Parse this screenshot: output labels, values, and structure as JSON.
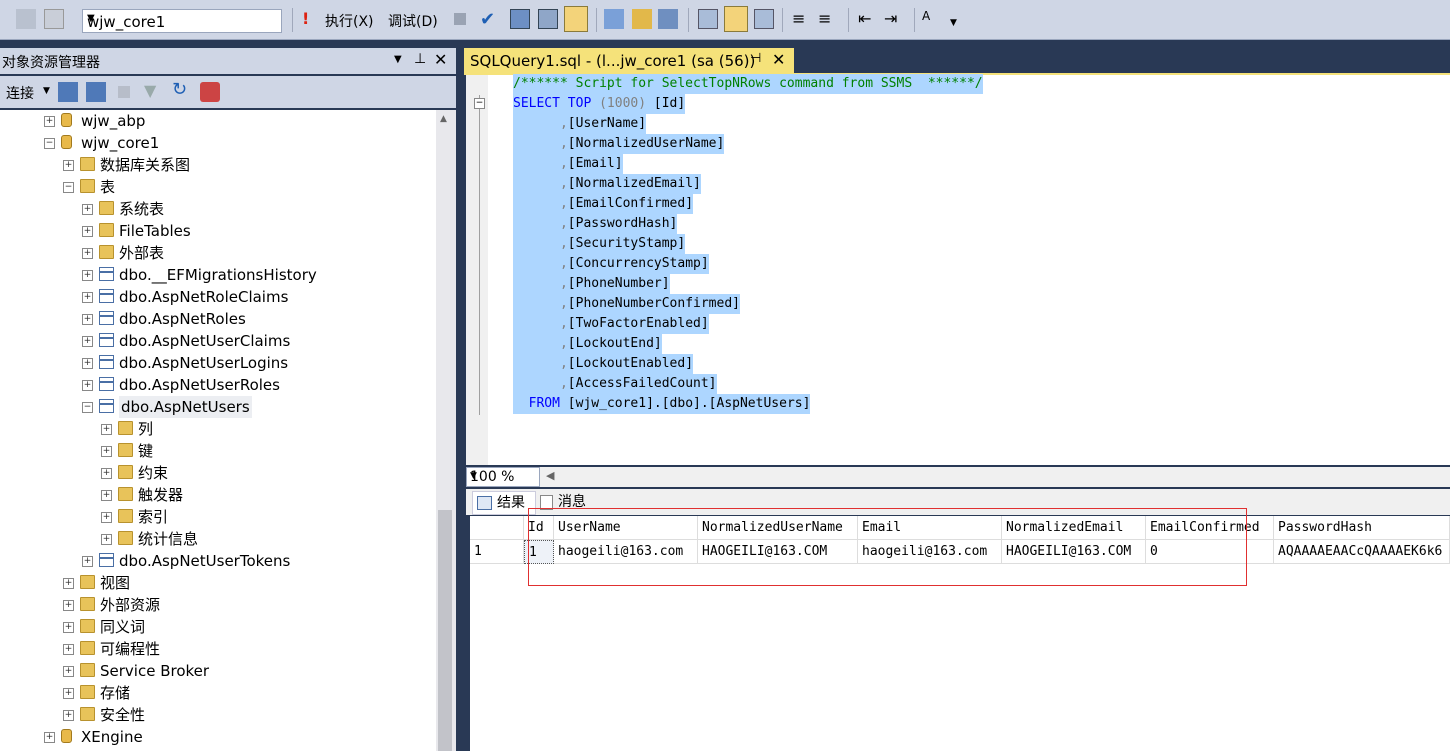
{
  "toolbar": {
    "database": "wjw_core1",
    "execute_label": "执行(X)",
    "debug_label": "调试(D)"
  },
  "object_explorer": {
    "title": "对象资源管理器",
    "connect_label": "连接",
    "tree": [
      {
        "label": "wjw_abp",
        "type": "db",
        "level": 2,
        "expanded": false
      },
      {
        "label": "wjw_core1",
        "type": "db",
        "level": 2,
        "expanded": true
      },
      {
        "label": "数据库关系图",
        "type": "folder",
        "level": 3,
        "expanded": false
      },
      {
        "label": "表",
        "type": "folder",
        "level": 3,
        "expanded": true
      },
      {
        "label": "系统表",
        "type": "folder",
        "level": 4,
        "expanded": false
      },
      {
        "label": "FileTables",
        "type": "folder",
        "level": 4,
        "expanded": false
      },
      {
        "label": "外部表",
        "type": "folder",
        "level": 4,
        "expanded": false
      },
      {
        "label": "dbo.__EFMigrationsHistory",
        "type": "table",
        "level": 4,
        "expanded": false
      },
      {
        "label": "dbo.AspNetRoleClaims",
        "type": "table",
        "level": 4,
        "expanded": false
      },
      {
        "label": "dbo.AspNetRoles",
        "type": "table",
        "level": 4,
        "expanded": false
      },
      {
        "label": "dbo.AspNetUserClaims",
        "type": "table",
        "level": 4,
        "expanded": false
      },
      {
        "label": "dbo.AspNetUserLogins",
        "type": "table",
        "level": 4,
        "expanded": false
      },
      {
        "label": "dbo.AspNetUserRoles",
        "type": "table",
        "level": 4,
        "expanded": false
      },
      {
        "label": "dbo.AspNetUsers",
        "type": "table",
        "level": 4,
        "expanded": true
      },
      {
        "label": "列",
        "type": "folder",
        "level": 5,
        "expanded": false
      },
      {
        "label": "键",
        "type": "folder",
        "level": 5,
        "expanded": false
      },
      {
        "label": "约束",
        "type": "folder",
        "level": 5,
        "expanded": false
      },
      {
        "label": "触发器",
        "type": "folder",
        "level": 5,
        "expanded": false
      },
      {
        "label": "索引",
        "type": "folder",
        "level": 5,
        "expanded": false
      },
      {
        "label": "统计信息",
        "type": "folder",
        "level": 5,
        "expanded": false
      },
      {
        "label": "dbo.AspNetUserTokens",
        "type": "table",
        "level": 4,
        "expanded": false
      },
      {
        "label": "视图",
        "type": "folder",
        "level": 3,
        "expanded": false
      },
      {
        "label": "外部资源",
        "type": "folder",
        "level": 3,
        "expanded": false
      },
      {
        "label": "同义词",
        "type": "folder",
        "level": 3,
        "expanded": false
      },
      {
        "label": "可编程性",
        "type": "folder",
        "level": 3,
        "expanded": false
      },
      {
        "label": "Service Broker",
        "type": "folder",
        "level": 3,
        "expanded": false
      },
      {
        "label": "存储",
        "type": "folder",
        "level": 3,
        "expanded": false
      },
      {
        "label": "安全性",
        "type": "folder",
        "level": 3,
        "expanded": false
      },
      {
        "label": "XEngine",
        "type": "db",
        "level": 2,
        "expanded": false
      }
    ]
  },
  "editor": {
    "tab_title": "SQLQuery1.sql - (l...jw_core1 (sa (56))",
    "lines": [
      {
        "text": "/****** Script for SelectTopNRows command from SSMS  ******/",
        "kind": "comment"
      },
      {
        "text": "SELECT TOP (1000) [Id]",
        "kind": "select"
      },
      {
        "text": "      ,[UserName]",
        "kind": "col"
      },
      {
        "text": "      ,[NormalizedUserName]",
        "kind": "col"
      },
      {
        "text": "      ,[Email]",
        "kind": "col"
      },
      {
        "text": "      ,[NormalizedEmail]",
        "kind": "col"
      },
      {
        "text": "      ,[EmailConfirmed]",
        "kind": "col"
      },
      {
        "text": "      ,[PasswordHash]",
        "kind": "col"
      },
      {
        "text": "      ,[SecurityStamp]",
        "kind": "col"
      },
      {
        "text": "      ,[ConcurrencyStamp]",
        "kind": "col"
      },
      {
        "text": "      ,[PhoneNumber]",
        "kind": "col"
      },
      {
        "text": "      ,[PhoneNumberConfirmed]",
        "kind": "col"
      },
      {
        "text": "      ,[TwoFactorEnabled]",
        "kind": "col"
      },
      {
        "text": "      ,[LockoutEnd]",
        "kind": "col"
      },
      {
        "text": "      ,[LockoutEnabled]",
        "kind": "col"
      },
      {
        "text": "      ,[AccessFailedCount]",
        "kind": "col"
      },
      {
        "text": "  FROM [wjw_core1].[dbo].[AspNetUsers]",
        "kind": "from"
      }
    ]
  },
  "zoom": "100 %",
  "results_tabs": {
    "results": "结果",
    "messages": "消息"
  },
  "grid": {
    "columns": [
      "",
      "Id",
      "UserName",
      "NormalizedUserName",
      "Email",
      "NormalizedEmail",
      "EmailConfirmed",
      "PasswordHash"
    ],
    "rows": [
      [
        "1",
        "1",
        "haogeili@163.com",
        "HAOGEILI@163.COM",
        "haogeili@163.com",
        "HAOGEILI@163.COM",
        "0",
        "AQAAAAEAACcQAAAAEK6k6"
      ]
    ]
  },
  "colors": {
    "selection": "#add6ff",
    "keyword": "#0000ff",
    "comment": "#008000",
    "tab_active": "#f5e27a",
    "highlight_box": "#e03030"
  }
}
